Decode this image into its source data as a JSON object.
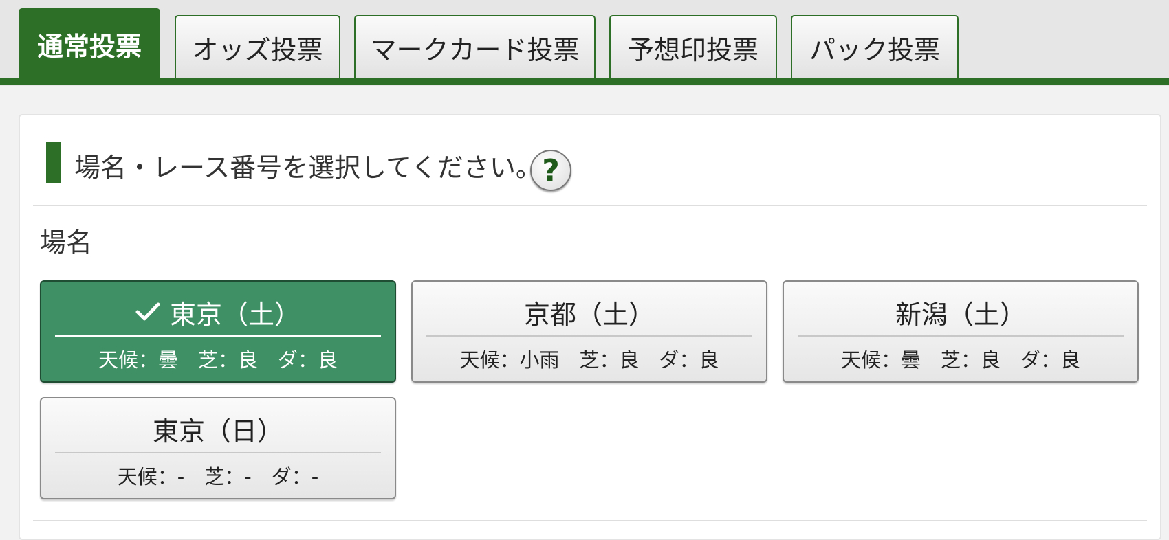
{
  "tabs": [
    {
      "label": "通常投票",
      "active": true
    },
    {
      "label": "オッズ投票",
      "active": false
    },
    {
      "label": "マークカード投票",
      "active": false
    },
    {
      "label": "予想印投票",
      "active": false
    },
    {
      "label": "パック投票",
      "active": false
    }
  ],
  "section": {
    "heading": "場名・レース番号を選択してください。",
    "help_label": "?",
    "venue_label": "場名"
  },
  "venues": [
    {
      "name": "東京（土）",
      "weather": "天候：曇　芝：良　ダ：良",
      "selected": true
    },
    {
      "name": "京都（土）",
      "weather": "天候：小雨　芝：良　ダ：良",
      "selected": false
    },
    {
      "name": "新潟（土）",
      "weather": "天候：曇　芝：良　ダ：良",
      "selected": false
    },
    {
      "name": "東京（日）",
      "weather": "天候：-　芝：-　ダ：-",
      "selected": false
    }
  ],
  "colors": {
    "brand_green": "#2e6f27",
    "selected_green": "#3f9064"
  },
  "icons": {
    "selected_marker": "check-icon",
    "help": "help-icon"
  }
}
